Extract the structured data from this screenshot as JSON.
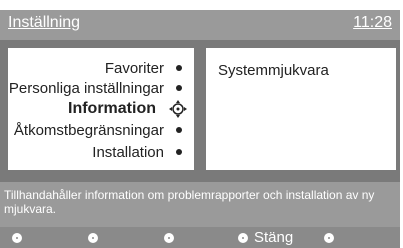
{
  "header": {
    "title": "Inställning",
    "clock": "11:28"
  },
  "menu": {
    "items": [
      {
        "label": "Favoriter",
        "active": false
      },
      {
        "label": "Personliga inställningar",
        "active": false
      },
      {
        "label": "Information",
        "active": true
      },
      {
        "label": "Åtkomstbegränsningar",
        "active": false
      },
      {
        "label": "Installation",
        "active": false
      }
    ]
  },
  "info": {
    "text": "Systemmjukvara"
  },
  "description": "Tillhandahåller information om problemrapporter och installation av ny mjukvara.",
  "bottom": {
    "close_label": "Stäng"
  },
  "icons": {
    "selector": "navigation-cursor-icon",
    "bullet": "bullet-dot-icon"
  },
  "colors": {
    "panel": "#7a7a7a",
    "titlebar": "#9a9a9a",
    "bar": "#8a8a8a"
  }
}
